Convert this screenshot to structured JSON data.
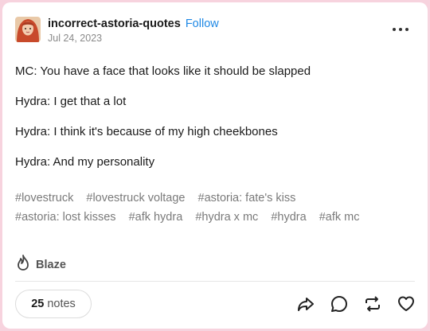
{
  "post": {
    "blog_name": "incorrect-astoria-quotes",
    "follow_label": "Follow",
    "date": "Jul 24, 2023",
    "lines": [
      "MC: You have a face that looks like it should be slapped",
      "Hydra: I get that a lot",
      "Hydra: I think it's because of my high cheekbones",
      "Hydra: And my personality"
    ],
    "tags": [
      "#lovestruck",
      "#lovestruck voltage",
      "#astoria: fate's kiss",
      "#astoria: lost kisses",
      "#afk hydra",
      "#hydra x mc",
      "#hydra",
      "#afk mc"
    ]
  },
  "footer": {
    "blaze_label": "Blaze",
    "notes_count": "25",
    "notes_label": "notes"
  },
  "icons": {
    "avatar": "avatar-image",
    "more": "more-icon",
    "blaze": "flame-icon",
    "share": "share-icon",
    "reply": "reply-icon",
    "reblog": "reblog-icon",
    "like": "heart-icon"
  },
  "colors": {
    "background": "#f7d3de",
    "follow": "#1e88e5",
    "tag": "#7a7a7a"
  }
}
